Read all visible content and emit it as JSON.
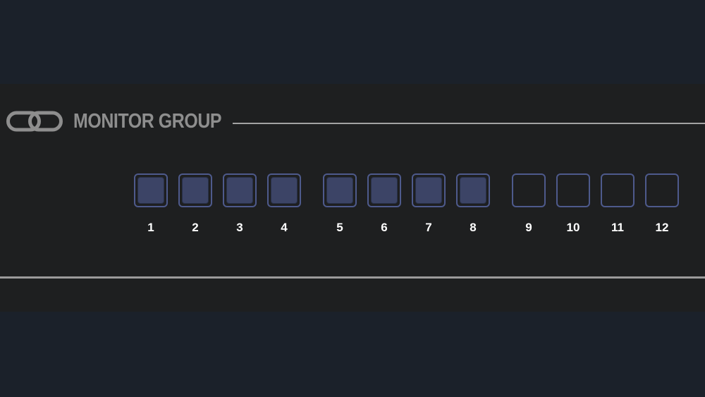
{
  "header": {
    "title": "MONITOR GROUP",
    "icon": "link-icon"
  },
  "colors": {
    "background": "#1b212a",
    "panel": "#1e1f20",
    "accent_border": "#4e5a8c",
    "active_fill": "#3c4466",
    "title_text": "#8e8e8e",
    "label_text": "#ffffff"
  },
  "monitors": [
    {
      "label": "1",
      "active": true
    },
    {
      "label": "2",
      "active": true
    },
    {
      "label": "3",
      "active": true
    },
    {
      "label": "4",
      "active": true
    },
    {
      "label": "5",
      "active": true
    },
    {
      "label": "6",
      "active": true
    },
    {
      "label": "7",
      "active": true
    },
    {
      "label": "8",
      "active": true
    },
    {
      "label": "9",
      "active": false
    },
    {
      "label": "10",
      "active": false
    },
    {
      "label": "11",
      "active": false
    },
    {
      "label": "12",
      "active": false
    }
  ]
}
